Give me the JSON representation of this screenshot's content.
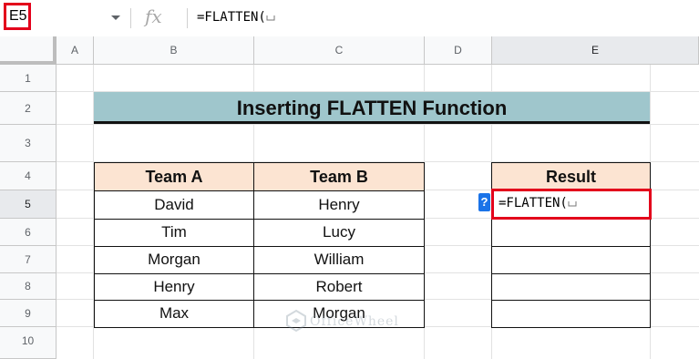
{
  "formula_bar": {
    "name_box": "E5",
    "fx_label": "fx",
    "formula": "=FLATTEN("
  },
  "grid": {
    "columns": [
      "A",
      "B",
      "C",
      "D",
      "E"
    ],
    "rows": [
      "1",
      "2",
      "3",
      "4",
      "5",
      "6",
      "7",
      "8",
      "9",
      "10"
    ],
    "active_column": "E",
    "active_row": "5"
  },
  "title": "Inserting FLATTEN Function",
  "team_table": {
    "headers": [
      "Team A",
      "Team B"
    ],
    "rows": [
      [
        "David",
        "Henry"
      ],
      [
        "Tim",
        "Lucy"
      ],
      [
        "Morgan",
        "William"
      ],
      [
        "Henry",
        "Robert"
      ],
      [
        "Max",
        "Morgan"
      ]
    ]
  },
  "result_table": {
    "header": "Result",
    "active_cell_text": "=FLATTEN(",
    "help_badge": "?",
    "empty_rows": 4
  },
  "watermark": {
    "text": "OfficeWheel"
  },
  "colors": {
    "title_bg": "#9fc6cc",
    "header_bg": "#fce4d2",
    "highlight": "#e3001b",
    "help_badge": "#1a73e8"
  }
}
